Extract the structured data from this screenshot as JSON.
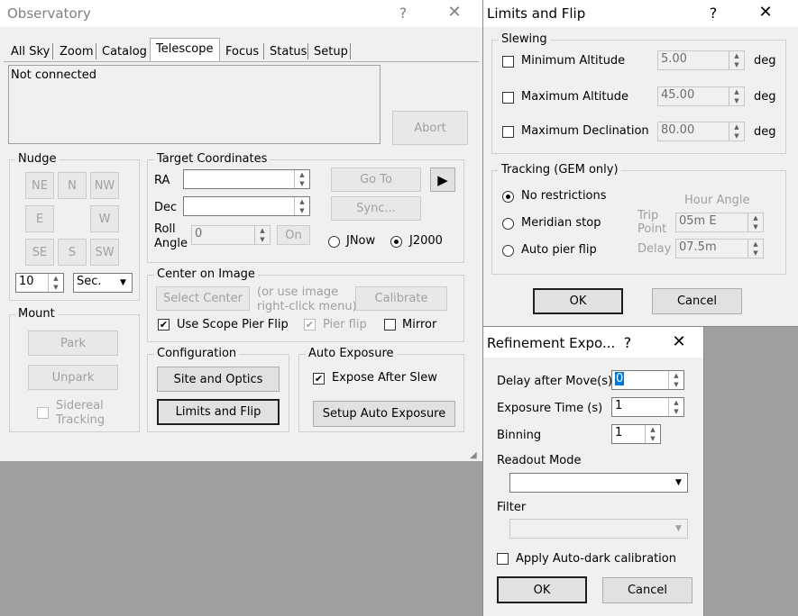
{
  "observatory": {
    "title": "Observatory",
    "help_icon": "?",
    "close_icon": "✕",
    "tabs": [
      "All Sky",
      "Zoom",
      "Catalog",
      "Telescope",
      "Focus",
      "Status",
      "Setup"
    ],
    "status_text": "Not connected",
    "abort": "Abort",
    "nudge": {
      "title": "Nudge",
      "ne": "NE",
      "n": "N",
      "nw": "NW",
      "e": "E",
      "w": "W",
      "se": "SE",
      "s": "S",
      "sw": "SW",
      "amount": "10",
      "unit": "Sec."
    },
    "target": {
      "title": "Target Coordinates",
      "ra": "RA",
      "dec": "Dec",
      "roll_label": "Roll",
      "angle_label": "Angle",
      "roll_value": "0",
      "on": "On",
      "goto": "Go To",
      "sync": "Sync...",
      "jnow": "JNow",
      "j2000": "J2000"
    },
    "mount": {
      "title": "Mount",
      "park": "Park",
      "unpark": "Unpark",
      "sidereal1": "Sidereal",
      "sidereal2": "Tracking"
    },
    "center": {
      "title": "Center on Image",
      "select": "Select Center",
      "hint1": "(or use image",
      "hint2": "right-click menu)",
      "calibrate": "Calibrate",
      "pierflip": "Use Scope Pier Flip",
      "pierflip2": "Pier flip",
      "mirror": "Mirror"
    },
    "config": {
      "title": "Configuration",
      "site": "Site and Optics",
      "limits": "Limits and Flip"
    },
    "autoexp": {
      "title": "Auto Exposure",
      "expose": "Expose After Slew",
      "setup": "Setup Auto Exposure"
    }
  },
  "limits": {
    "title": "Limits and Flip",
    "help_icon": "?",
    "close_icon": "✕",
    "slewing": "Slewing",
    "min_alt": "Minimum Altitude",
    "min_alt_val": "5.00",
    "max_alt": "Maximum Altitude",
    "max_alt_val": "45.00",
    "max_dec": "Maximum Declination",
    "max_dec_val": "80.00",
    "deg": "deg",
    "tracking": "Tracking (GEM only)",
    "no_restr": "No restrictions",
    "meridian": "Meridian stop",
    "autoflip": "Auto pier flip",
    "hour_angle": "Hour Angle",
    "trip1": "Trip",
    "trip2": "Point",
    "trip_val": "05m E",
    "delay": "Delay",
    "delay_val": "07.5m",
    "ok": "OK",
    "cancel": "Cancel"
  },
  "refine": {
    "title": "Refinement Expo...",
    "help_icon": "?",
    "close_icon": "✕",
    "delay": "Delay after Move(s)",
    "delay_val": "0",
    "exptime": "Exposure Time (s)",
    "exptime_val": "1",
    "binning": "Binning",
    "binning_val": "1",
    "readout": "Readout Mode",
    "filter": "Filter",
    "autodark": "Apply Auto-dark calibration",
    "ok": "OK",
    "cancel": "Cancel"
  }
}
